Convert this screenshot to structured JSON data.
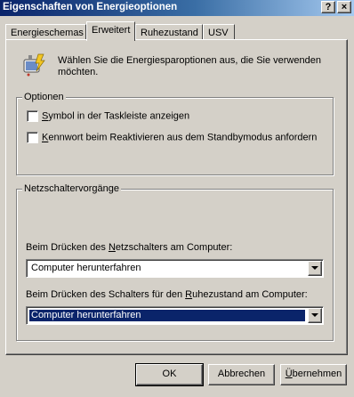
{
  "window": {
    "title": "Eigenschaften von Energieoptionen",
    "help_label": "?",
    "close_label": "×"
  },
  "tabs": [
    {
      "label": "Energieschemas"
    },
    {
      "label": "Erweitert"
    },
    {
      "label": "Ruhezustand"
    },
    {
      "label": "USV"
    }
  ],
  "intro": {
    "line1": "Wählen Sie die Energiesparoptionen aus, die Sie verwenden",
    "line2": "möchten."
  },
  "options": {
    "legend": "Optionen",
    "items": [
      {
        "pre": "",
        "accel": "S",
        "post": "ymbol in der Taskleiste anzeigen",
        "checked": false
      },
      {
        "pre": "",
        "accel": "K",
        "post": "ennwort beim Reaktivieren aus dem Standbymodus anfordern",
        "checked": false
      }
    ]
  },
  "power_buttons": {
    "legend": "Netzschaltervorgänge",
    "power": {
      "label_pre": "Beim Drücken des ",
      "label_accel": "N",
      "label_post": "etzschalters am Computer:",
      "value": "Computer herunterfahren"
    },
    "sleep": {
      "label_pre": "Beim Drücken des Schalters für den ",
      "label_accel": "R",
      "label_post": "uhezustand am Computer:",
      "value": "Computer herunterfahren"
    }
  },
  "buttons": {
    "ok": "OK",
    "cancel": "Abbrechen",
    "apply_accel": "Ü",
    "apply_rest": "bernehmen"
  }
}
